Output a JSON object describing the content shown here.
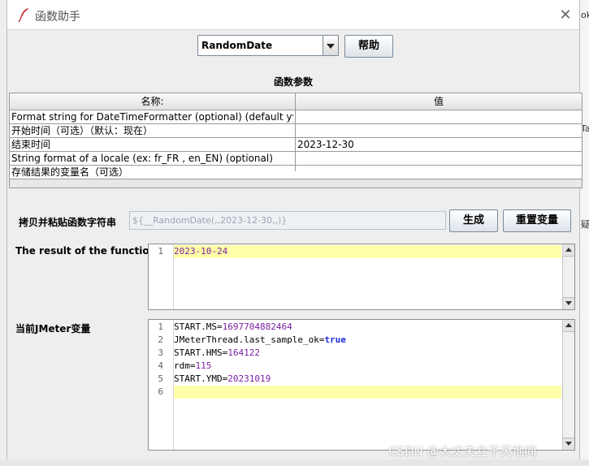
{
  "window": {
    "title": "函数助手",
    "close_glyph": "✕"
  },
  "function_select": {
    "selected": "RandomDate"
  },
  "buttons": {
    "help": "帮助",
    "generate": "生成",
    "reset_vars": "重置变量"
  },
  "params": {
    "title": "函数参数",
    "columns": [
      "名称:",
      "值"
    ],
    "rows": [
      {
        "name": "Format string for DateTimeFormatter (optional) (default yyyy-M...",
        "value": ""
      },
      {
        "name": "开始时间（可选）（默认：现在）",
        "value": ""
      },
      {
        "name": "结束时间",
        "value": "2023-12-30"
      },
      {
        "name": "String format of a locale (ex: fr_FR , en_EN) (optional)",
        "value": ""
      },
      {
        "name": "存储结果的变量名（可选）",
        "value": ""
      }
    ]
  },
  "copy": {
    "label": "拷贝并粘贴函数字符串",
    "value": "${__RandomDate(,,2023-12-30,,)}"
  },
  "result": {
    "label": "The result of the function is",
    "lines": [
      {
        "num": "1",
        "text": "2023-10-24"
      }
    ]
  },
  "jmeter_vars": {
    "label": "当前JMeter变量",
    "lines": [
      {
        "num": "1",
        "key": "START.MS",
        "eq": "=",
        "value": "1697704882464"
      },
      {
        "num": "2",
        "key": "JMeterThread.last_sample_ok",
        "eq": "=",
        "value": "true"
      },
      {
        "num": "3",
        "key": "START.HMS",
        "eq": "=",
        "value": "164122"
      },
      {
        "num": "4",
        "key": "rdm",
        "eq": "=",
        "value": "115"
      },
      {
        "num": "5",
        "key": "START.YMD",
        "eq": "=",
        "value": "20231019"
      },
      {
        "num": "6",
        "key": "",
        "eq": "",
        "value": ""
      }
    ]
  },
  "background_fragments": [
    "ok",
    "Ta",
    "疑"
  ],
  "watermark": "CSDN @大丈夫立于天地间",
  "colors": {
    "highlight_line": "#ffffaa",
    "number_value": "#7a1fa2",
    "keyword": "#1b2bd6"
  }
}
